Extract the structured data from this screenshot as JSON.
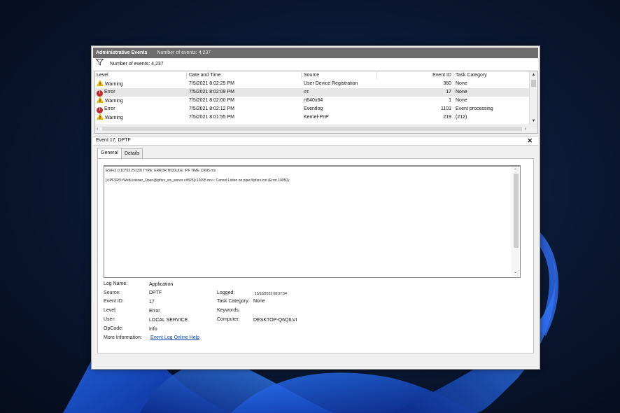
{
  "header": {
    "title": "Administrative Events",
    "count_text": "Number of events: 4,237"
  },
  "filter": {
    "icon": "filter-icon",
    "text": "Number of events: 4,237"
  },
  "columns": [
    "Level",
    "Date and Time",
    "Source",
    "Event ID",
    "Task Category"
  ],
  "rows": [
    {
      "level": "Warning",
      "date": "7/5/2021 8:02:25 PM",
      "source": "User Device Registration",
      "id": "360",
      "category": "None"
    },
    {
      "level": "Error",
      "date": "7/5/2021 8:02:09 PM",
      "source": "IPF",
      "id": "17",
      "category": "None"
    },
    {
      "level": "Warning",
      "date": "7/5/2021 8:02:00 PM",
      "source": "rt640x64",
      "id": "1",
      "category": "None"
    },
    {
      "level": "Error",
      "date": "7/5/2021 8:02:12 PM",
      "source": "Eventlog",
      "id": "1101",
      "category": "Event processing"
    },
    {
      "level": "Warning",
      "date": "7/5/2021 8:01:55 PM",
      "source": "Kernel-PnP",
      "id": "219",
      "category": "(212)"
    }
  ],
  "detail": {
    "title": "Event 17, DPTF",
    "tabs": [
      "General",
      "Details"
    ],
    "message_line1": "ESIF(1.0.10702.25133) TYPE: ERROR MODULE: IPF TIME 12695 ms",
    "message_line2": "[<IPFSRV>WebListener_Open@ipfsrv_ws_server.c#825]<12695 ms>: Cannot Listen on pipe://ipfsrv.icst (Error 10050)",
    "labels": {
      "log_name": "Log Name:",
      "source": "Source:",
      "event_id": "Event ID:",
      "level": "Level:",
      "user": "User:",
      "opcode": "OpCode:",
      "more_info": "More Information:",
      "logged": "Logged:",
      "task_category": "Task Category:",
      "keywords": "Keywords:",
      "computer": "Computer:"
    },
    "values": {
      "log_name": "Application",
      "source": "DPTF",
      "event_id": "17",
      "level": "Error",
      "user": "LOCAL SERVICE",
      "opcode": "Info",
      "more_info": "Event Log Online Help",
      "logged": "13/10/2023 08:37:54",
      "task_category": "None",
      "keywords": "",
      "computer": "DESKTOP-Q6QILVI"
    }
  },
  "colors": {
    "header_bg": "#6d6d6d",
    "selected_row": "#e6e6e6",
    "warning": "#f2b705",
    "error": "#c62828",
    "link": "#0645ad"
  }
}
